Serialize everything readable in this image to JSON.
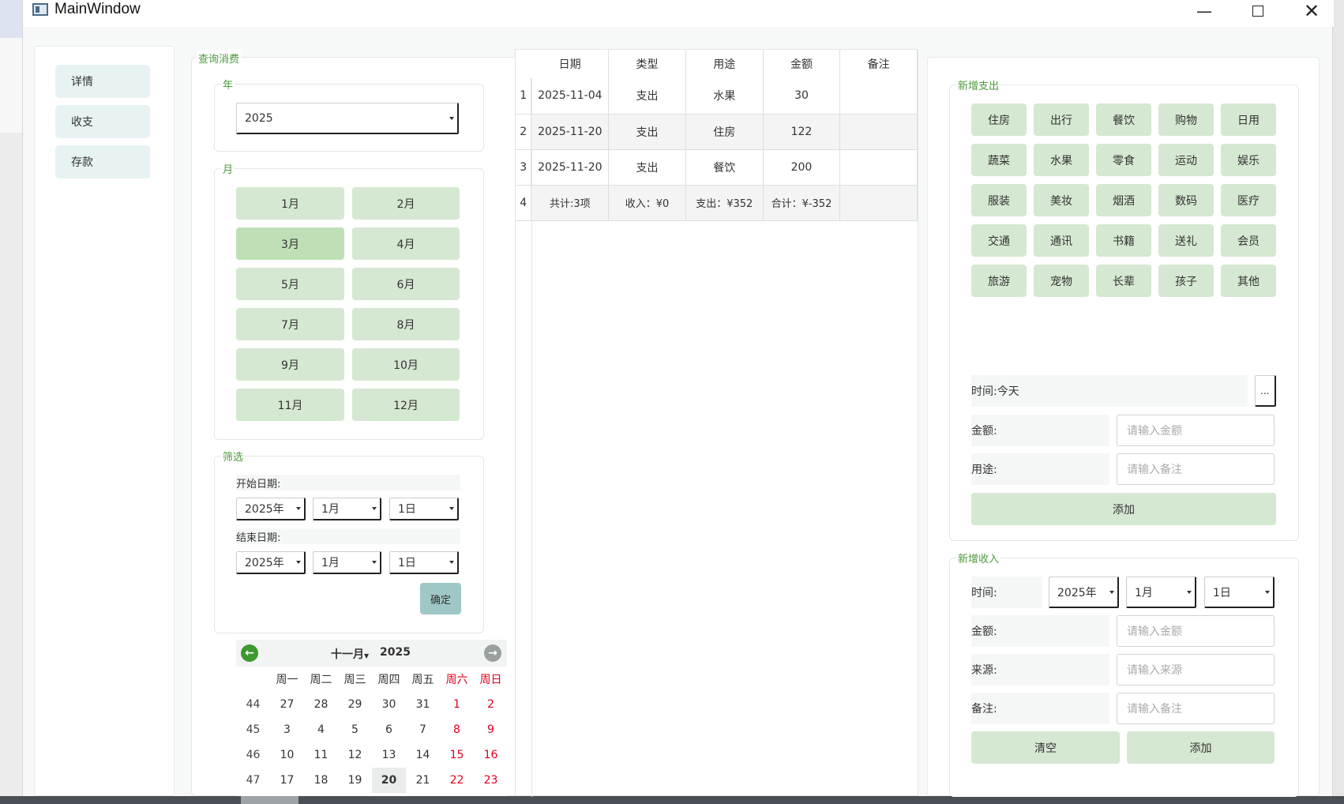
{
  "window": {
    "title": "MainWindow"
  },
  "nav": {
    "items": [
      "详情",
      "收支",
      "存款"
    ]
  },
  "query": {
    "title": "查询消费",
    "year_group": "年",
    "year_value": "2025",
    "month_group": "月",
    "months": [
      "1月",
      "2月",
      "3月",
      "4月",
      "5月",
      "6月",
      "7月",
      "8月",
      "9月",
      "10月",
      "11月",
      "12月"
    ],
    "selected_month": "3月",
    "filter_group": "筛选",
    "start_label": "开始日期:",
    "end_label": "结束日期:",
    "start": {
      "year": "2025年",
      "month": "1月",
      "day": "1日"
    },
    "end": {
      "year": "2025年",
      "month": "1月",
      "day": "1日"
    },
    "confirm": "确定"
  },
  "calendar": {
    "month": "十一月",
    "year": "2025",
    "weekdays": [
      "周一",
      "周二",
      "周三",
      "周四",
      "周五",
      "周六",
      "周日"
    ],
    "weeks": [
      {
        "wk": "44",
        "days": [
          "27",
          "28",
          "29",
          "30",
          "31",
          "1",
          "2"
        ]
      },
      {
        "wk": "45",
        "days": [
          "3",
          "4",
          "5",
          "6",
          "7",
          "8",
          "9"
        ]
      },
      {
        "wk": "46",
        "days": [
          "10",
          "11",
          "12",
          "13",
          "14",
          "15",
          "16"
        ]
      },
      {
        "wk": "47",
        "days": [
          "17",
          "18",
          "19",
          "20",
          "21",
          "22",
          "23"
        ]
      }
    ],
    "today": "20"
  },
  "table": {
    "columns": [
      "日期",
      "类型",
      "用途",
      "金额",
      "备注"
    ],
    "rows": [
      {
        "num": "1",
        "cells": [
          "2025-11-04",
          "支出",
          "水果",
          "30",
          ""
        ]
      },
      {
        "num": "2",
        "cells": [
          "2025-11-20",
          "支出",
          "住房",
          "122",
          ""
        ]
      },
      {
        "num": "3",
        "cells": [
          "2025-11-20",
          "支出",
          "餐饮",
          "200",
          ""
        ]
      },
      {
        "num": "4",
        "cells": [
          "共计:3项",
          "收入：¥0",
          "支出：¥352",
          "合计：¥-352",
          ""
        ]
      }
    ]
  },
  "expense": {
    "title": "新增支出",
    "categories": [
      "住房",
      "出行",
      "餐饮",
      "购物",
      "日用",
      "蔬菜",
      "水果",
      "零食",
      "运动",
      "娱乐",
      "服装",
      "美妆",
      "烟酒",
      "数码",
      "医疗",
      "交通",
      "通讯",
      "书籍",
      "送礼",
      "会员",
      "旅游",
      "宠物",
      "长辈",
      "孩子",
      "其他"
    ],
    "time_label": "时间:今天",
    "more_btn": "...",
    "amount_label": "金额:",
    "amount_placeholder": "请输入金额",
    "purpose_label": "用途:",
    "purpose_placeholder": "请输入备注",
    "add": "添加"
  },
  "income": {
    "title": "新增收入",
    "time_label": "时间:",
    "year": "2025年",
    "month": "1月",
    "day": "1日",
    "amount_label": "金额:",
    "amount_placeholder": "请输入金额",
    "source_label": "来源:",
    "source_placeholder": "请输入来源",
    "note_label": "备注:",
    "note_placeholder": "请输入备注",
    "clear": "清空",
    "add": "添加"
  },
  "colors": {
    "accent_green": "#d5e8d1",
    "group_title": "#4c9a3c",
    "weekend_red": "#e0001a"
  }
}
